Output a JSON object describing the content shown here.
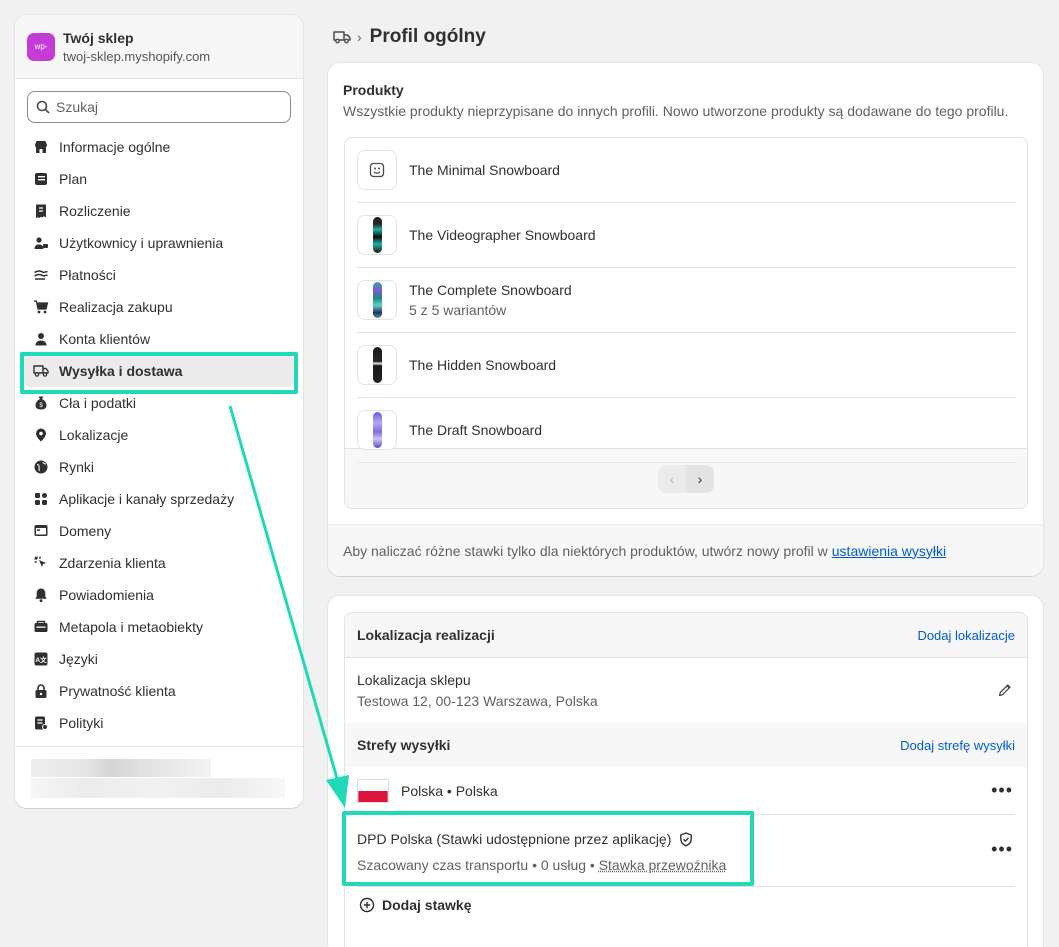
{
  "sidebar": {
    "store_logo_text": "wp-",
    "store_name": "Twój sklep",
    "store_url": "twoj-sklep.myshopify.com",
    "search_placeholder": "Szukaj",
    "items": [
      {
        "label": "Informacje ogólne",
        "icon": "store-icon"
      },
      {
        "label": "Plan",
        "icon": "plan-icon"
      },
      {
        "label": "Rozliczenie",
        "icon": "receipt-icon"
      },
      {
        "label": "Użytkownicy i uprawnienia",
        "icon": "users-icon"
      },
      {
        "label": "Płatności",
        "icon": "payment-icon"
      },
      {
        "label": "Realizacja zakupu",
        "icon": "cart-icon"
      },
      {
        "label": "Konta klientów",
        "icon": "person-icon"
      },
      {
        "label": "Wysyłka i dostawa",
        "icon": "truck-icon",
        "active": true
      },
      {
        "label": "Cła i podatki",
        "icon": "money-bag-icon"
      },
      {
        "label": "Lokalizacje",
        "icon": "location-icon"
      },
      {
        "label": "Rynki",
        "icon": "globe-icon"
      },
      {
        "label": "Aplikacje i kanały sprzedaży",
        "icon": "apps-icon"
      },
      {
        "label": "Domeny",
        "icon": "domain-icon"
      },
      {
        "label": "Zdarzenia klienta",
        "icon": "cursor-icon"
      },
      {
        "label": "Powiadomienia",
        "icon": "bell-icon"
      },
      {
        "label": "Metapola i metaobiekty",
        "icon": "metafields-icon"
      },
      {
        "label": "Języki",
        "icon": "language-icon"
      },
      {
        "label": "Prywatność klienta",
        "icon": "lock-icon"
      },
      {
        "label": "Polityki",
        "icon": "policy-icon"
      }
    ]
  },
  "header": {
    "breadcrumb_icon": "truck-icon",
    "separator": "›",
    "title": "Profil ogólny"
  },
  "products_card": {
    "title": "Produkty",
    "description": "Wszystkie produkty nieprzypisane do innych profili. Nowo utworzone produkty są dodawane do tego profilu.",
    "products": [
      {
        "name": "The Minimal Snowboard",
        "subtitle": "",
        "image": "placeholder"
      },
      {
        "name": "The Videographer Snowboard",
        "subtitle": "",
        "image": "snowboard-teal"
      },
      {
        "name": "The Complete Snowboard",
        "subtitle": "5 z 5 wariantów",
        "image": "snowboard-multicolor"
      },
      {
        "name": "The Hidden Snowboard",
        "subtitle": "",
        "image": "snowboard-dark"
      },
      {
        "name": "The Draft Snowboard",
        "subtitle": "",
        "image": "snowboard-purple"
      }
    ],
    "pager_prev": "‹",
    "pager_next": "›",
    "footer_text": "Aby naliczać różne stawki tylko dla niektórych produktów, utwórz nowy profil w",
    "footer_link": "ustawienia wysyłki"
  },
  "shipping_card": {
    "fulfillment_title": "Lokalizacja realizacji",
    "fulfillment_action": "Dodaj lokalizacje",
    "location_name": "Lokalizacja sklepu",
    "location_address": "Testowa 12, 00-123 Warszawa, Polska",
    "zones_title": "Strefy wysyłki",
    "zones_action": "Dodaj strefę wysyłki",
    "zone_name": "Polska • Polska",
    "rate_name": "DPD Polska (Stawki udostępnione przez aplikację)",
    "rate_meta": "Szacowany czas transportu • 0 usług • ",
    "rate_type": "Stawka przewoźnika",
    "add_rate": "Dodaj stawkę",
    "more": "•••"
  },
  "colors": {
    "highlight": "#1fd9b7",
    "link": "#005bd3",
    "store_logo": "#c43bd6"
  }
}
